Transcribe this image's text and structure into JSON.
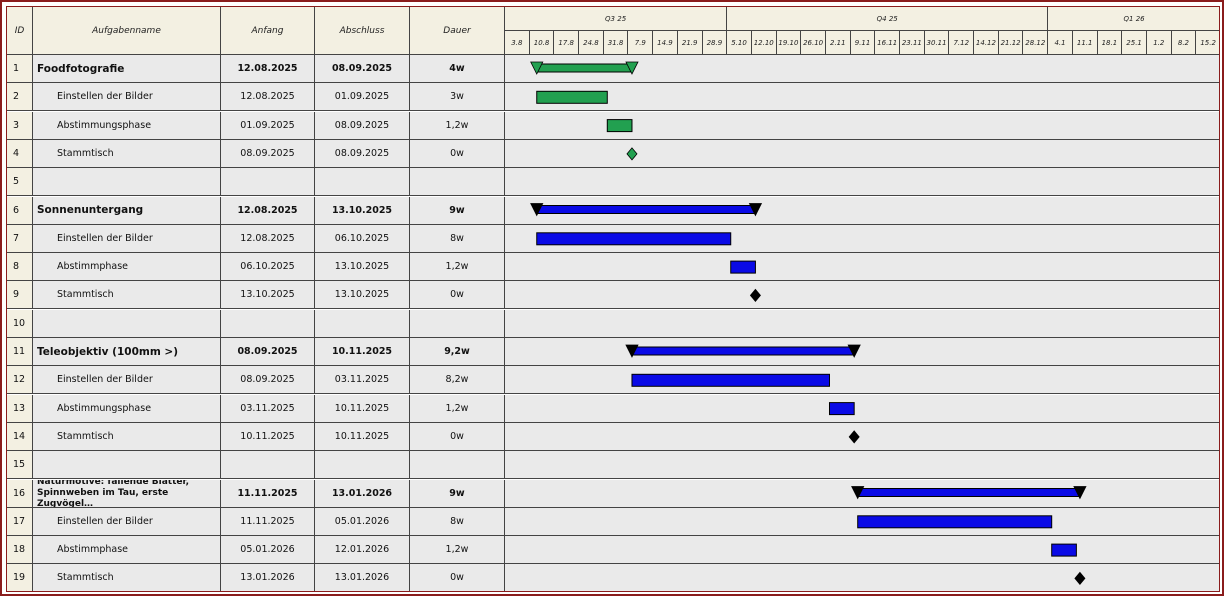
{
  "headers": {
    "id": "ID",
    "name": "Aufgabenname",
    "start": "Anfang",
    "end": "Abschluss",
    "duration": "Dauer"
  },
  "timeline": {
    "quarters": [
      "Q3 25",
      "Q4 25",
      "Q1 26"
    ],
    "weeks": [
      "3.8",
      "10.8",
      "17.8",
      "24.8",
      "31.8",
      "7.9",
      "14.9",
      "21.9",
      "28.9",
      "5.10",
      "12.10",
      "19.10",
      "26.10",
      "2.11",
      "9.11",
      "16.11",
      "23.11",
      "30.11",
      "7.12",
      "14.12",
      "21.12",
      "28.12",
      "4.1",
      "11.1",
      "18.1",
      "25.1",
      "1.2",
      "8.2",
      "15.2"
    ]
  },
  "tasks": [
    {
      "id": "1",
      "name": "Foodfotografie",
      "start": "12.08.2025",
      "end": "08.09.2025",
      "duration": "4w",
      "type": "summary",
      "color": "#22a050"
    },
    {
      "id": "2",
      "name": "Einstellen der Bilder",
      "start": "12.08.2025",
      "end": "01.09.2025",
      "duration": "3w",
      "type": "task",
      "color": "#22a050"
    },
    {
      "id": "3",
      "name": "Abstimmungsphase",
      "start": "01.09.2025",
      "end": "08.09.2025",
      "duration": "1,2w",
      "type": "task",
      "color": "#22a050"
    },
    {
      "id": "4",
      "name": "Stammtisch",
      "start": "08.09.2025",
      "end": "08.09.2025",
      "duration": "0w",
      "type": "milestone",
      "color": "#22a050"
    },
    {
      "id": "5",
      "name": "",
      "start": "",
      "end": "",
      "duration": "",
      "type": "empty"
    },
    {
      "id": "6",
      "name": "Sonnenuntergang",
      "start": "12.08.2025",
      "end": "13.10.2025",
      "duration": "9w",
      "type": "summary",
      "color": "#0a0ae6"
    },
    {
      "id": "7",
      "name": "Einstellen der Bilder",
      "start": "12.08.2025",
      "end": "06.10.2025",
      "duration": "8w",
      "type": "task",
      "color": "#0a0ae6"
    },
    {
      "id": "8",
      "name": "Abstimmphase",
      "start": "06.10.2025",
      "end": "13.10.2025",
      "duration": "1,2w",
      "type": "task",
      "color": "#0a0ae6"
    },
    {
      "id": "9",
      "name": "Stammtisch",
      "start": "13.10.2025",
      "end": "13.10.2025",
      "duration": "0w",
      "type": "milestone",
      "color": "#000000"
    },
    {
      "id": "10",
      "name": "",
      "start": "",
      "end": "",
      "duration": "",
      "type": "empty"
    },
    {
      "id": "11",
      "name": "Teleobjektiv (100mm >)",
      "start": "08.09.2025",
      "end": "10.11.2025",
      "duration": "9,2w",
      "type": "summary",
      "color": "#0a0ae6"
    },
    {
      "id": "12",
      "name": "Einstellen der Bilder",
      "start": "08.09.2025",
      "end": "03.11.2025",
      "duration": "8,2w",
      "type": "task",
      "color": "#0a0ae6"
    },
    {
      "id": "13",
      "name": "Abstimmungsphase",
      "start": "03.11.2025",
      "end": "10.11.2025",
      "duration": "1,2w",
      "type": "task",
      "color": "#0a0ae6"
    },
    {
      "id": "14",
      "name": "Stammtisch",
      "start": "10.11.2025",
      "end": "10.11.2025",
      "duration": "0w",
      "type": "milestone",
      "color": "#000000"
    },
    {
      "id": "15",
      "name": "",
      "start": "",
      "end": "",
      "duration": "",
      "type": "empty"
    },
    {
      "id": "16",
      "name": "Naturmotive: fallende Blätter, Spinnweben im Tau, erste Zugvögel…",
      "start": "11.11.2025",
      "end": "13.01.2026",
      "duration": "9w",
      "type": "summary",
      "color": "#0a0ae6"
    },
    {
      "id": "17",
      "name": "Einstellen der Bilder",
      "start": "11.11.2025",
      "end": "05.01.2026",
      "duration": "8w",
      "type": "task",
      "color": "#0a0ae6"
    },
    {
      "id": "18",
      "name": "Abstimmphase",
      "start": "05.01.2026",
      "end": "12.01.2026",
      "duration": "1,2w",
      "type": "task",
      "color": "#0a0ae6"
    },
    {
      "id": "19",
      "name": "Stammtisch",
      "start": "13.01.2026",
      "end": "13.01.2026",
      "duration": "0w",
      "type": "milestone",
      "color": "#000000"
    }
  ],
  "colors": {
    "header_bg": "#f3f0e2",
    "row_bg": "#eaeaea",
    "frame": "#8a1c1c",
    "green": "#22a050",
    "blue": "#0a0ae6"
  }
}
